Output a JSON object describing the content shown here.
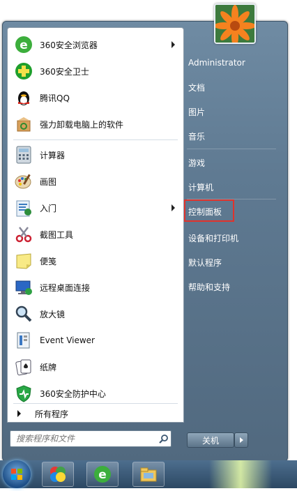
{
  "user": {
    "name": "Administrator"
  },
  "programs": [
    {
      "label": "360安全浏览器",
      "icon": "360-browser-icon",
      "submenu": true
    },
    {
      "label": "360安全卫士",
      "icon": "360-guard-icon",
      "submenu": false
    },
    {
      "label": "腾讯QQ",
      "icon": "qq-penguin-icon",
      "submenu": false
    },
    {
      "label": "强力卸载电脑上的软件",
      "icon": "uninstall-box-icon",
      "submenu": false
    },
    {
      "label": "计算器",
      "icon": "calculator-icon",
      "submenu": false
    },
    {
      "label": "画图",
      "icon": "paint-palette-icon",
      "submenu": false
    },
    {
      "label": "入门",
      "icon": "getting-started-icon",
      "submenu": true
    },
    {
      "label": "截图工具",
      "icon": "scissors-icon",
      "submenu": false
    },
    {
      "label": "便笺",
      "icon": "sticky-note-icon",
      "submenu": false
    },
    {
      "label": "远程桌面连接",
      "icon": "remote-desktop-icon",
      "submenu": false
    },
    {
      "label": "放大镜",
      "icon": "magnifier-icon",
      "submenu": false
    },
    {
      "label": "Event Viewer",
      "icon": "event-viewer-icon",
      "submenu": false
    },
    {
      "label": "纸牌",
      "icon": "solitaire-cards-icon",
      "submenu": false
    },
    {
      "label": "360安全防护中心",
      "icon": "360-shield-icon",
      "submenu": false
    }
  ],
  "all_programs_label": "所有程序",
  "search": {
    "placeholder": "搜索程序和文件"
  },
  "right_menu": [
    {
      "label": "文档"
    },
    {
      "label": "图片"
    },
    {
      "label": "音乐"
    },
    {
      "label": "游戏"
    },
    {
      "label": "计算机"
    },
    {
      "label": "控制面板",
      "highlighted": true
    },
    {
      "label": "设备和打印机"
    },
    {
      "label": "默认程序"
    },
    {
      "label": "帮助和支持"
    }
  ],
  "shutdown_label": "关机",
  "colors": {
    "highlight_box": "#e0332c",
    "menu_bg": "#5f7a92",
    "taskbar_bg": "#2c4863"
  },
  "taskbar": {
    "items": [
      "360-balls-icon",
      "360-browser-icon",
      "file-explorer-icon"
    ]
  }
}
